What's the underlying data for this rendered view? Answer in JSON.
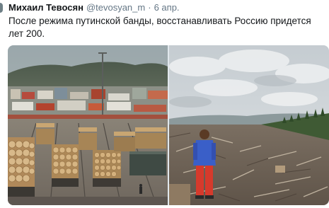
{
  "tweet": {
    "author_name": "Михаил Тевосян",
    "handle": "@tevosyan_m",
    "separator": "·",
    "date": "6 апр.",
    "text": "После режима путинской банды, восстанавливать Россию придется лет 200."
  },
  "colors": {
    "text_primary": "#14171a",
    "text_secondary": "#657786",
    "jacket_blue": "#3a5fc8",
    "pants_red": "#d63a2c"
  },
  "media": {
    "left_photo": "freight-train-with-logs",
    "right_photo": "child-looking-at-clearcut-forest"
  }
}
